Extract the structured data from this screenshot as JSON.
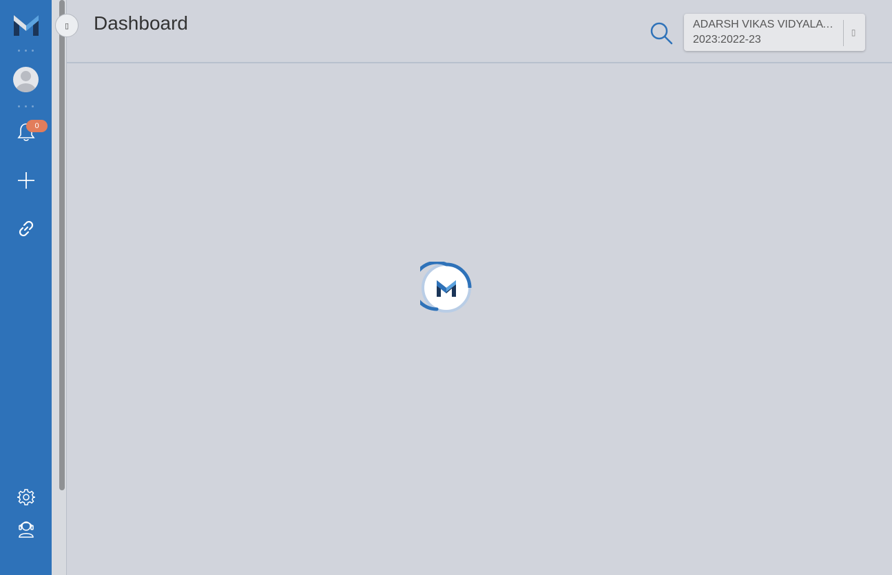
{
  "app": {
    "brand": "M"
  },
  "header": {
    "title": "Dashboard",
    "collapse_icon": "▯"
  },
  "school_selector": {
    "school_name": "ADARSH VIKAS VIDYALAYA",
    "session": "2023:2022-23",
    "arrow_icon": "▯"
  },
  "notifications": {
    "count": "0"
  },
  "colors": {
    "sidebar": "#2e72b9",
    "background": "#d1d4dc",
    "badge": "#e27d5b",
    "accent": "#2e72b9"
  },
  "icons": [
    "logo-icon",
    "avatar-icon",
    "bell-icon",
    "plus-icon",
    "link-icon",
    "gear-icon",
    "support-icon",
    "search-icon",
    "loader-logo-icon"
  ]
}
